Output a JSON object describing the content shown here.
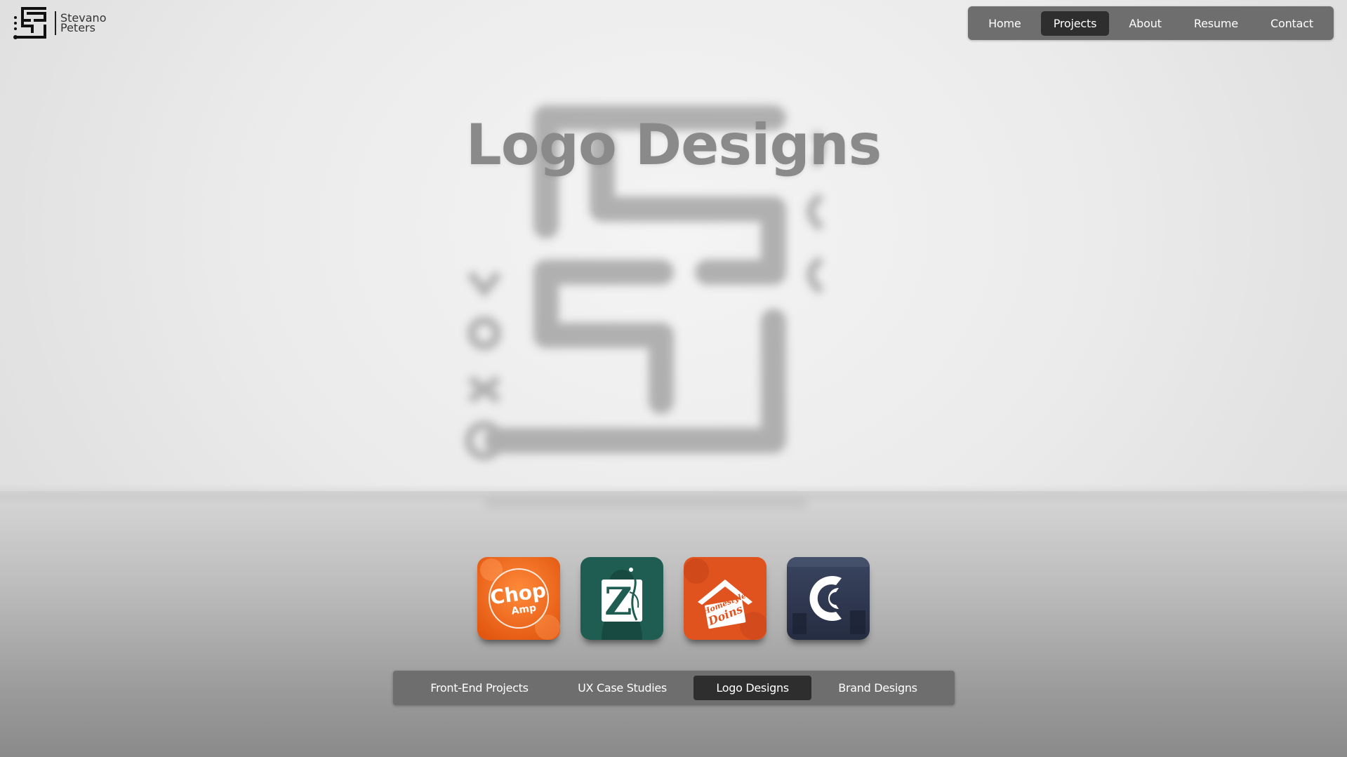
{
  "brand": {
    "first_name": "Stevano",
    "last_name": "Peters",
    "icon": "sp-monogram-logo"
  },
  "topnav": {
    "items": [
      {
        "label": "Home",
        "active": false
      },
      {
        "label": "Projects",
        "active": true
      },
      {
        "label": "About",
        "active": false
      },
      {
        "label": "Resume",
        "active": false
      },
      {
        "label": "Contact",
        "active": false
      }
    ]
  },
  "hero": {
    "title": "Logo Designs",
    "background_icon": "sp-monogram-watermark"
  },
  "logos": [
    {
      "name": "chop-amp",
      "text_main": "Chop",
      "text_sub": "Amp",
      "color": "#f26a1b"
    },
    {
      "name": "peacock-z",
      "text_main": "Z",
      "color": "#1f5c52"
    },
    {
      "name": "homestyle-doins",
      "text_main": "Homestyle",
      "text_sub": "Doins",
      "color": "#e0531e"
    },
    {
      "name": "c-circle",
      "text_main": "C",
      "color": "#2f3a55"
    }
  ],
  "categories": [
    {
      "label": "Front-End Projects",
      "active": false
    },
    {
      "label": "UX Case Studies",
      "active": false
    },
    {
      "label": "Logo Designs",
      "active": true
    },
    {
      "label": "Brand Designs",
      "active": false
    }
  ],
  "colors": {
    "nav_bg": "#6e6e6e",
    "nav_active_bg": "#2e2e2e",
    "title": "#8a8a8a"
  }
}
